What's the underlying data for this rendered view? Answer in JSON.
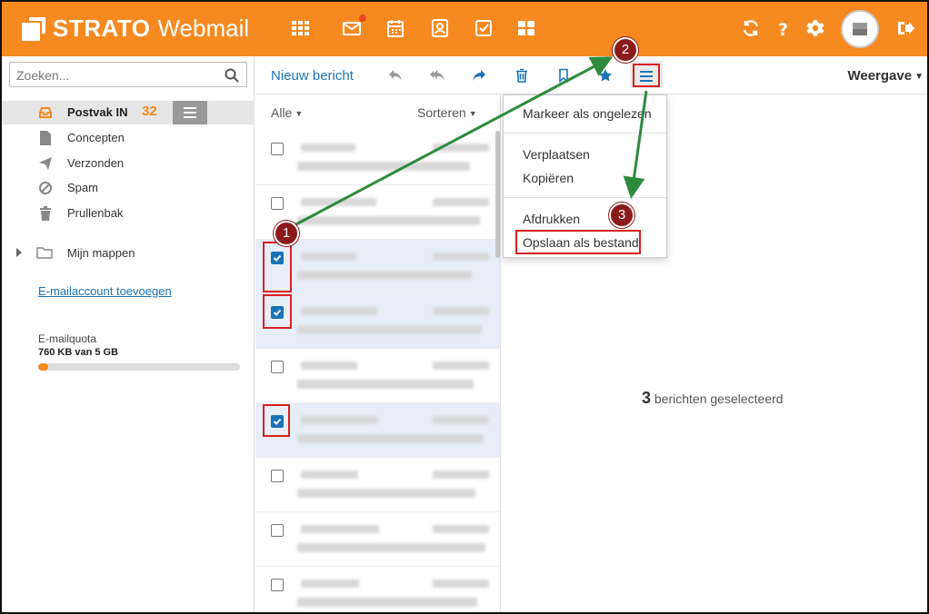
{
  "header": {
    "brand": "STRATO",
    "product": "Webmail",
    "nav_icons": [
      "apps-grid-icon",
      "mail-icon",
      "calendar-icon",
      "contacts-icon",
      "tasks-icon",
      "dashboard-icon"
    ],
    "right_icons": [
      "refresh-icon",
      "help-icon",
      "settings-icon",
      "avatar",
      "logout-icon"
    ],
    "accent_color": "#f6891f"
  },
  "sidebar": {
    "search_placeholder": "Zoeken...",
    "inbox": {
      "label": "Postvak IN",
      "count": "32"
    },
    "folders": [
      {
        "label": "Concepten",
        "icon": "document-icon"
      },
      {
        "label": "Verzonden",
        "icon": "send-icon"
      },
      {
        "label": "Spam",
        "icon": "ban-icon"
      },
      {
        "label": "Prullenbak",
        "icon": "trash-icon"
      }
    ],
    "my_folders": "Mijn mappen",
    "add_account": "E-mailaccount toevoegen",
    "quota": {
      "label": "E-mailquota",
      "value": "760 KB van 5 GB",
      "fraction": 0.05
    }
  },
  "toolbar": {
    "new_message": "Nieuw bericht",
    "view": "Weergave",
    "icons": [
      "reply-icon",
      "reply-all-icon",
      "forward-icon",
      "trash-icon",
      "bookmark-icon",
      "star-icon",
      "menu-icon"
    ]
  },
  "list": {
    "filter": "Alle",
    "sort": "Sorteren",
    "rows": [
      {
        "selected": false
      },
      {
        "selected": false
      },
      {
        "selected": true
      },
      {
        "selected": true
      },
      {
        "selected": false
      },
      {
        "selected": true
      },
      {
        "selected": false
      },
      {
        "selected": false
      },
      {
        "selected": false
      }
    ]
  },
  "dropdown": {
    "mark_unread": "Markeer als ongelezen",
    "move": "Verplaatsen",
    "copy": "Kopiëren",
    "print": "Afdrukken",
    "save_as_file": "Opslaan als bestand"
  },
  "reading_pane": {
    "count": "3",
    "text": "berichten geselecteerd"
  },
  "annotations": {
    "badge1": "1",
    "badge2": "2",
    "badge3": "3",
    "arrow_color": "#2e8b3e",
    "frame_color": "#d62020"
  }
}
